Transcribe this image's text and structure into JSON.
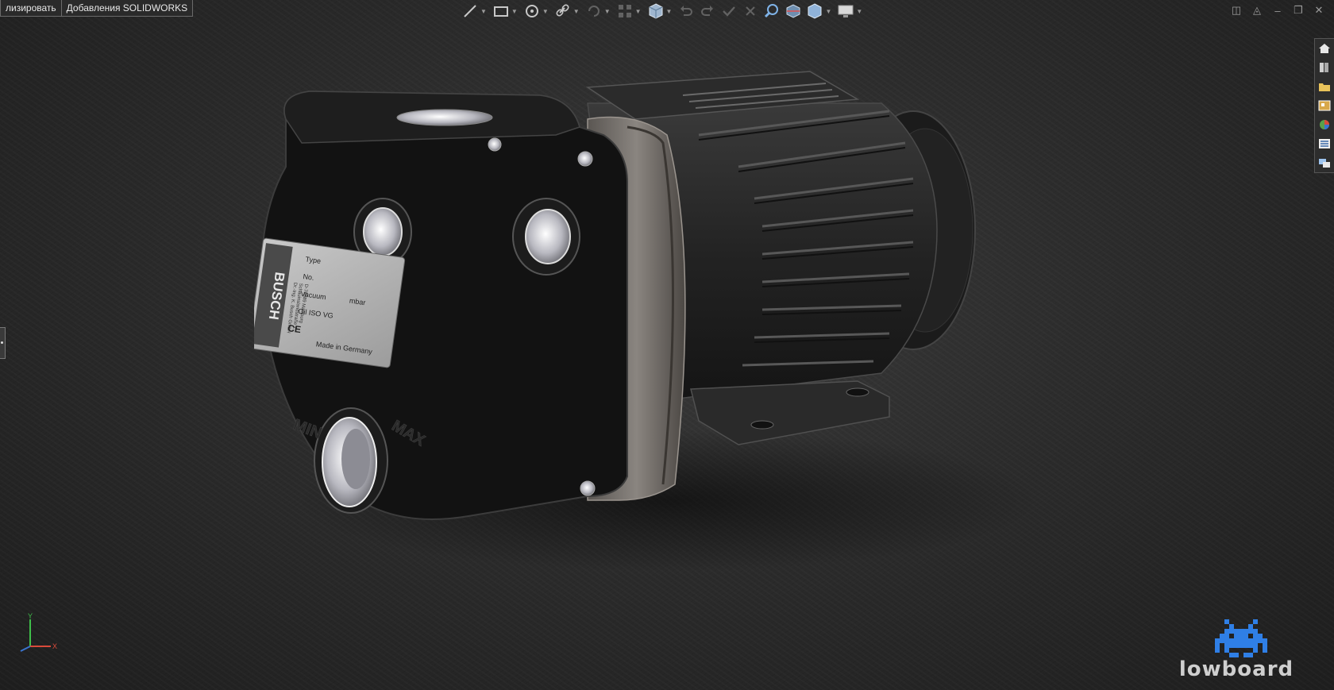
{
  "tabs": [
    {
      "label": "лизировать"
    },
    {
      "label": "Добавления SOLIDWORKS"
    }
  ],
  "toolbar": {
    "icons": [
      "sketch-line-icon",
      "rectangle-icon",
      "circle-icon",
      "link-icon",
      "rotate-icon",
      "pattern-icon",
      "view-orientation-icon",
      "undo-icon",
      "redo-icon",
      "confirm-icon",
      "cancel-icon",
      "zoom-icon",
      "section-view-icon",
      "display-style-icon",
      "monitor-icon"
    ]
  },
  "task_pane": {
    "icons": [
      "home-icon",
      "resources-icon",
      "folder-icon",
      "view-palette-icon",
      "appearances-icon",
      "custom-properties-icon",
      "forum-icon"
    ]
  },
  "nameplate": {
    "brand": "BUSCH",
    "company_lines": [
      "Dr.-Ing. K. Busch GmbH",
      "Schauinslandstraße 1",
      "D-79689 Maulburg"
    ],
    "type_label": "Type",
    "no_label": "No.",
    "vacuum_label": "Vacuum",
    "vacuum_unit": "mbar",
    "oil_label": "Oil ISO VG",
    "ce_mark": "CE",
    "origin": "Made in Germany"
  },
  "gauge_labels": {
    "min": "MIN",
    "max": "MAX"
  },
  "triad": {
    "y": "Y",
    "x": "X"
  },
  "logo": {
    "text": "lowboard"
  },
  "colors": {
    "background": "#2c2c2c",
    "accent_blue": "#2f7fe6",
    "tab_border": "#6a6a6a"
  }
}
